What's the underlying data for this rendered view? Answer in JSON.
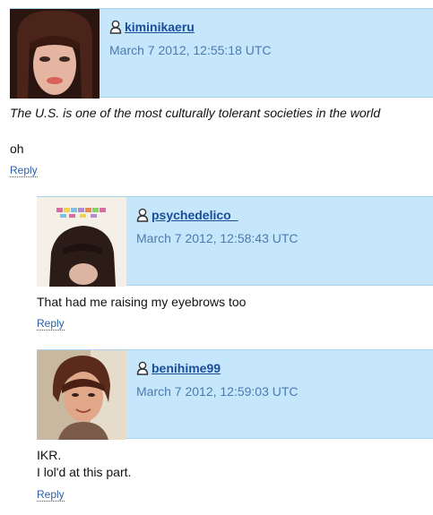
{
  "comments": [
    {
      "username": "kiminikaeru",
      "timestamp": "March 7 2012, 12:55:18 UTC",
      "lines": [
        "The U.S. is one of the most culturally tolerant societies in the world",
        "oh"
      ],
      "reply_label": "Reply"
    },
    {
      "username": "psychedelico_",
      "timestamp": "March 7 2012, 12:58:43 UTC",
      "lines": [
        "That had me raising my eyebrows too"
      ],
      "reply_label": "Reply"
    },
    {
      "username": "benihime99",
      "timestamp": "March 7 2012, 12:59:03 UTC",
      "lines": [
        "IKR.",
        "I lol'd at this part."
      ],
      "reply_label": "Reply"
    }
  ],
  "icons": {
    "user": "user-icon"
  },
  "colors": {
    "header_bg": "#c6e6fb",
    "username": "#1a4e99",
    "timestamp": "#4c7bb0",
    "reply_link": "#2a5ea8"
  }
}
